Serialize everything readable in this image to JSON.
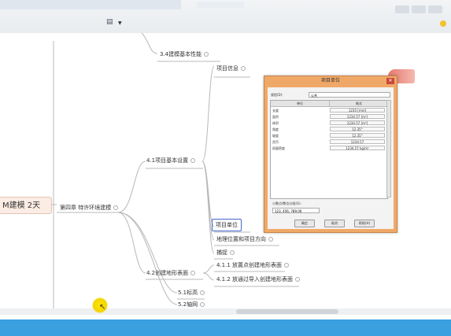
{
  "toolbar": {
    "tab_label": "",
    "doc_icon": "document-icon"
  },
  "mindmap": {
    "central": "M建模 2天",
    "chapter4": "第四章  特许环境建模",
    "n3_4": "3.4建模基本性能",
    "n4_1": "4.1项目基本设置",
    "n4_2": "4.2创建地形表面",
    "n_proj_info": "项目信息",
    "n_proj_units": "项目单位",
    "n_location": "地理位置和项目方向",
    "n_snap": "捕捉",
    "n4_1_1": "4.1.1 放置点创建地形表面",
    "n4_1_2": "4.1.2 放通过导入创建地形表面",
    "n5_1": "5.1标高",
    "n5_2": "5.2轴网"
  },
  "dialog": {
    "title": "项目单位",
    "discipline_label": "规程(D):",
    "discipline_value": "公共",
    "col_unit": "单位",
    "col_format": "格式",
    "rows": [
      {
        "unit": "长度",
        "format": "1235 [mm]"
      },
      {
        "unit": "面积",
        "format": "1234.57 [m²]"
      },
      {
        "unit": "体积",
        "format": "1234.57 [m³]"
      },
      {
        "unit": "角度",
        "format": "12.35°"
      },
      {
        "unit": "坡度",
        "format": "12.35°"
      },
      {
        "unit": "货币",
        "format": "1234.57"
      },
      {
        "unit": "质量密度",
        "format": "1234.57 kg/m³"
      }
    ],
    "grouping_label": "小数点/数位分组(G):",
    "grouping_value": "123, 456, 789.00",
    "ok": "确定",
    "cancel": "取消",
    "help": "帮助(H)"
  }
}
